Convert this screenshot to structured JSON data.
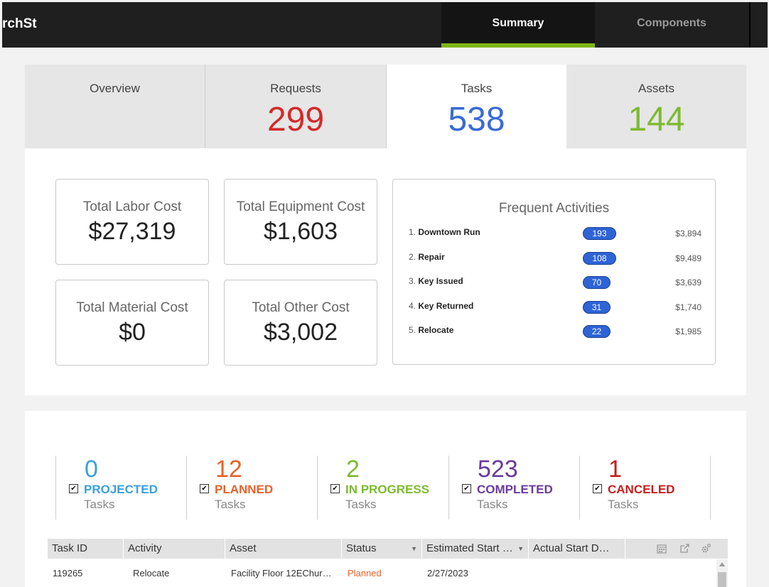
{
  "header": {
    "brand": "rchSt",
    "tabs": [
      {
        "label": "Summary",
        "active": true
      },
      {
        "label": "Components",
        "active": false
      }
    ]
  },
  "kpis": [
    {
      "label": "Overview",
      "value": "",
      "color": "#000000"
    },
    {
      "label": "Requests",
      "value": "299",
      "color": "#d42a2a"
    },
    {
      "label": "Tasks",
      "value": "538",
      "color": "#3a6bd4"
    },
    {
      "label": "Assets",
      "value": "144",
      "color": "#7cbb2f"
    }
  ],
  "costs": {
    "labor": {
      "label": "Total Labor Cost",
      "value": "$27,319"
    },
    "equipment": {
      "label": "Total Equipment Cost",
      "value": "$1,603"
    },
    "material": {
      "label": "Total Material Cost",
      "value": "$0"
    },
    "other": {
      "label": "Total Other Cost",
      "value": "$3,002"
    }
  },
  "frequent": {
    "title": "Frequent Activities",
    "items": [
      {
        "idx": "1.",
        "name": "Downtown Run",
        "count": "193",
        "amount": "$3,894"
      },
      {
        "idx": "2.",
        "name": "Repair",
        "count": "108",
        "amount": "$9,489"
      },
      {
        "idx": "3.",
        "name": "Key Issued",
        "count": "70",
        "amount": "$3,639"
      },
      {
        "idx": "4.",
        "name": "Key Returned",
        "count": "31",
        "amount": "$1,740"
      },
      {
        "idx": "5.",
        "name": "Relocate",
        "count": "22",
        "amount": "$1,985"
      }
    ]
  },
  "statuses": [
    {
      "count": "0",
      "name": "PROJECTED",
      "sub": "Tasks",
      "color": "#3aa0dc",
      "checked": true
    },
    {
      "count": "12",
      "name": "PLANNED",
      "sub": "Tasks",
      "color": "#e8622a",
      "checked": true
    },
    {
      "count": "2",
      "name": "IN PROGRESS",
      "sub": "Tasks",
      "color": "#7cbb2f",
      "checked": true
    },
    {
      "count": "523",
      "name": "COMPLETED",
      "sub": "Tasks",
      "color": "#6a3a9e",
      "checked": true
    },
    {
      "count": "1",
      "name": "CANCELED",
      "sub": "Tasks",
      "color": "#c81e1e",
      "checked": true
    }
  ],
  "grid": {
    "columns": [
      "Task ID",
      "Activity",
      "Asset",
      "Status",
      "Estimated Start …",
      "Actual Start D…"
    ],
    "icons": [
      "calendar-icon",
      "external-link-icon",
      "gear-icon"
    ],
    "rows": [
      {
        "task_id": "119265",
        "activity": "Relocate",
        "asset": "Facility Floor 12EChur…",
        "status": "Planned",
        "est_start": "2/27/2023",
        "actual_start": ""
      }
    ],
    "status_color": "#e8622a"
  }
}
